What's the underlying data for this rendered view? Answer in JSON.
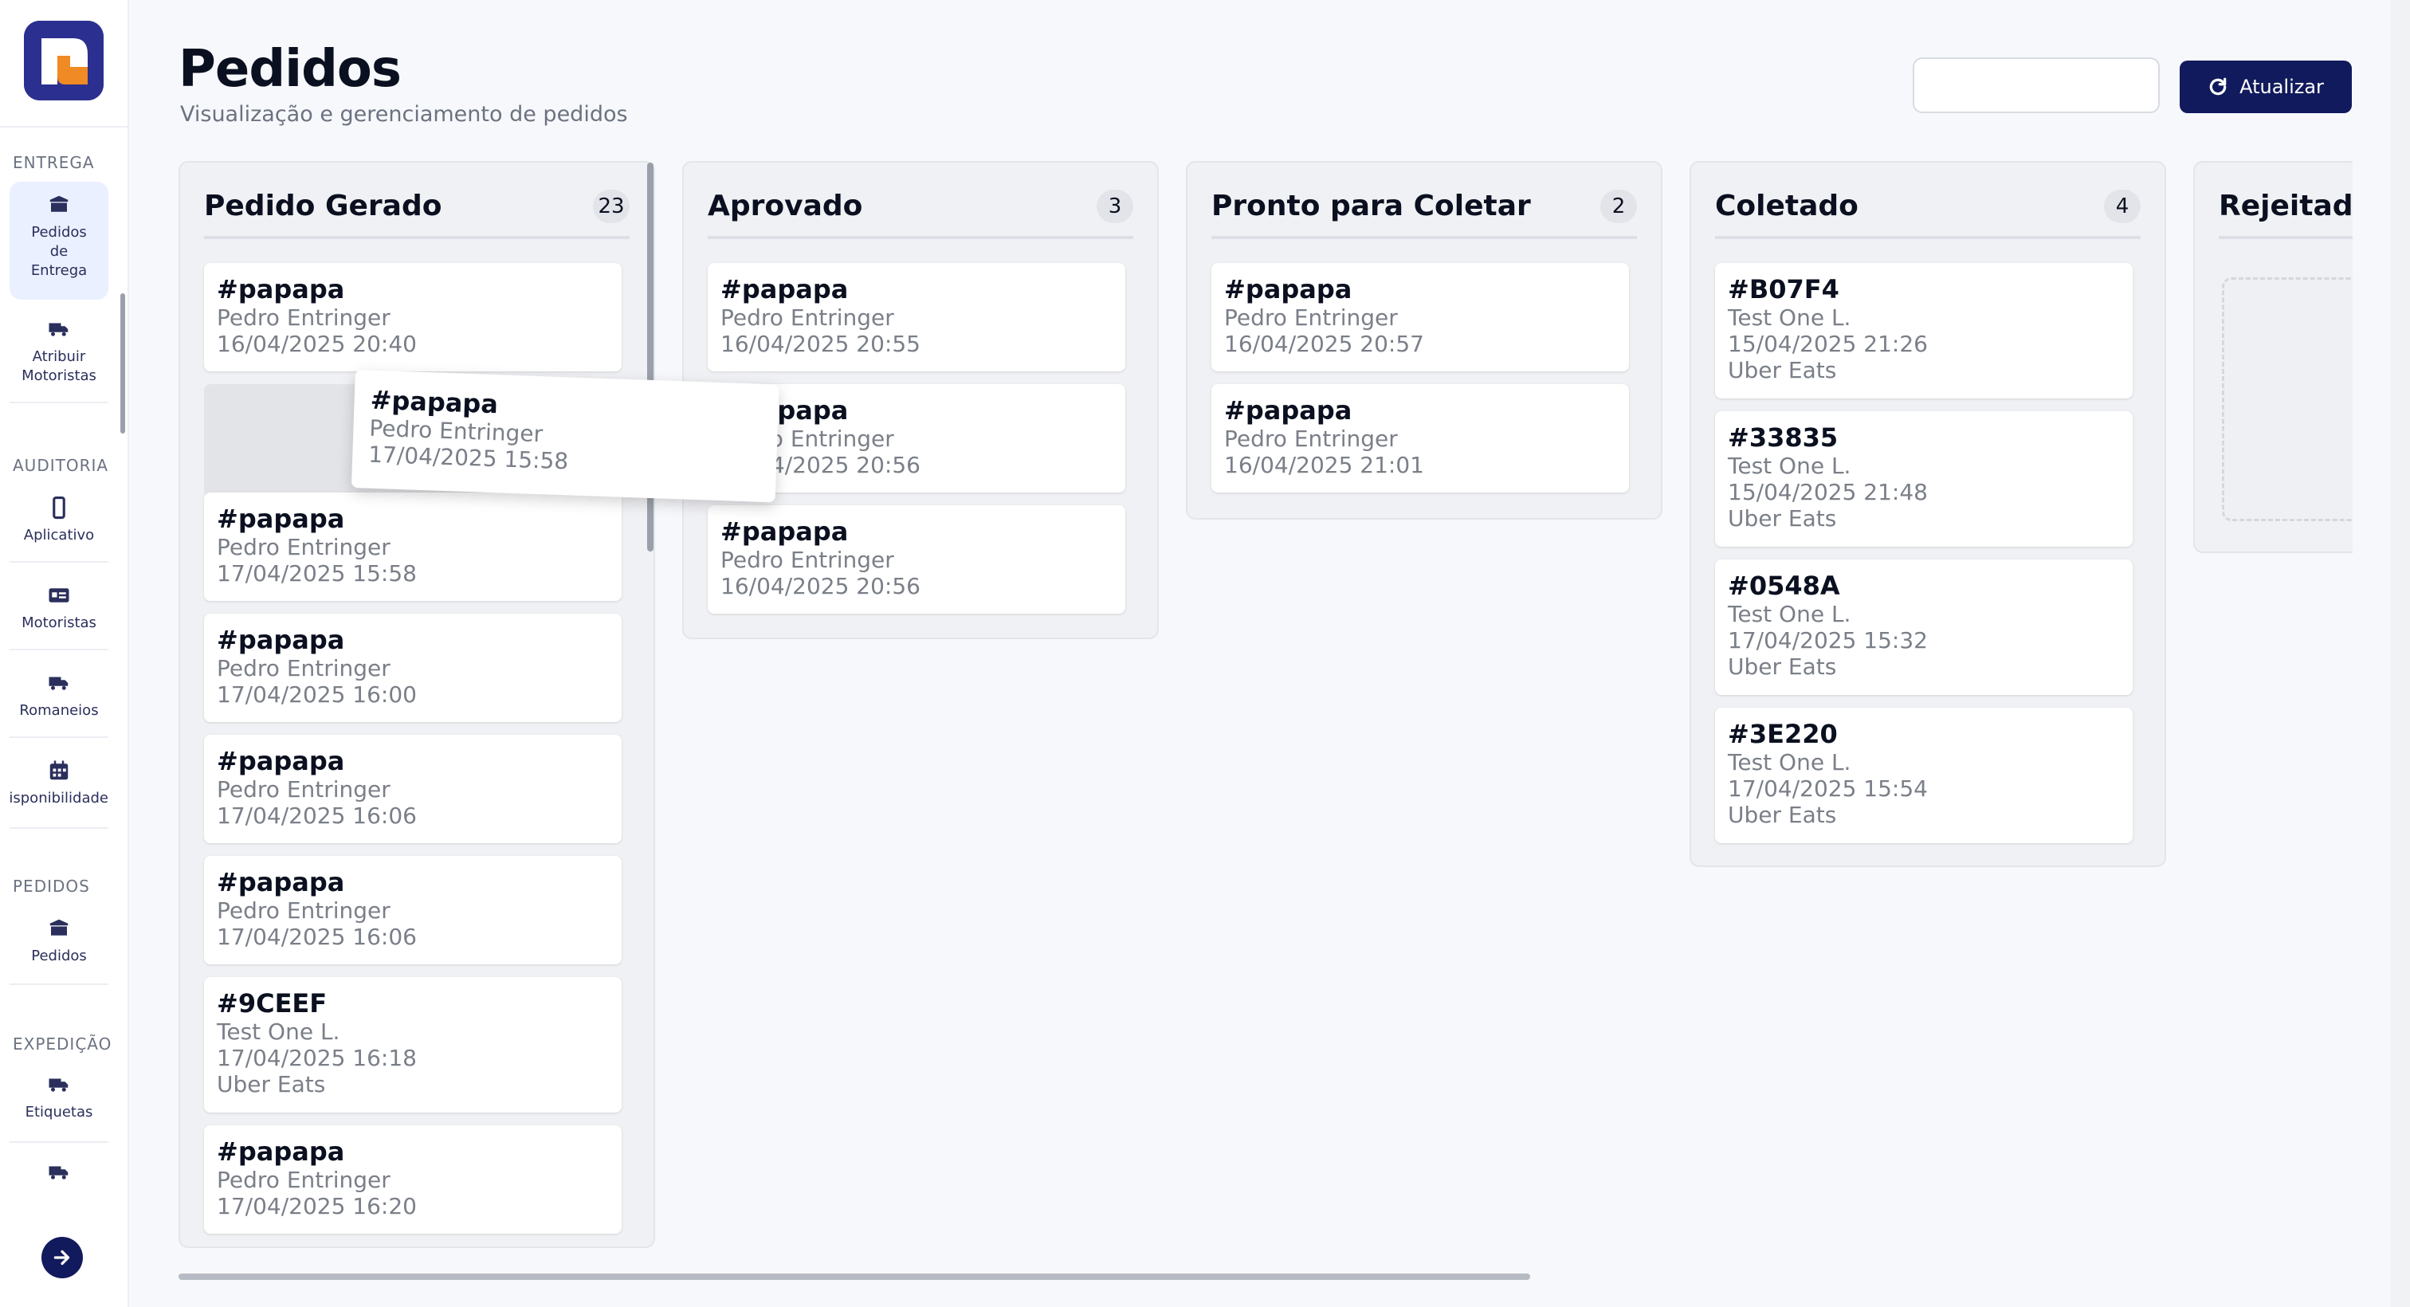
{
  "sidebar": {
    "sections": [
      {
        "title": "ENTREGA",
        "items": [
          {
            "label": "Pedidos de Entrega",
            "icon": "box-icon",
            "active": true
          },
          {
            "label": "Atribuir Motoristas",
            "icon": "truck-fast-icon"
          }
        ]
      },
      {
        "title": "AUDITORIA",
        "items": [
          {
            "label": "Aplicativo",
            "icon": "mobile-icon"
          },
          {
            "label": "Motoristas",
            "icon": "id-card-icon"
          },
          {
            "label": "Romaneios",
            "icon": "truck-icon"
          },
          {
            "label": "Disponibilidade",
            "icon": "calendar-icon"
          }
        ]
      },
      {
        "title": "PEDIDOS",
        "items": [
          {
            "label": "Pedidos",
            "icon": "box-icon"
          }
        ]
      },
      {
        "title": "EXPEDIÇÃO",
        "items": [
          {
            "label": "Etiquetas",
            "icon": "truck-fast-icon"
          },
          {
            "label": "",
            "icon": "truck-fast-icon"
          }
        ]
      }
    ],
    "expand_icon": "arrow-right-icon"
  },
  "header": {
    "title": "Pedidos",
    "subtitle": "Visualização e gerenciamento de pedidos",
    "search_value": "",
    "refresh_label": "Atualizar",
    "accent": "#111a5c"
  },
  "board": {
    "columns": [
      {
        "title": "Pedido Gerado",
        "count": "23",
        "cards": [
          {
            "id": "#papapa",
            "name": "Pedro Entringer",
            "date": "16/04/2025 20:40"
          },
          {
            "id": "#papapa",
            "name": "Pedro Entringer",
            "date": "17/04/2025 15:58"
          },
          {
            "id": "#papapa",
            "name": "Pedro Entringer",
            "date": "17/04/2025 16:00"
          },
          {
            "id": "#papapa",
            "name": "Pedro Entringer",
            "date": "17/04/2025 16:06"
          },
          {
            "id": "#papapa",
            "name": "Pedro Entringer",
            "date": "17/04/2025 16:06"
          },
          {
            "id": "#9CEEF",
            "name": "Test One L.",
            "date": "17/04/2025 16:18",
            "source": "Uber Eats"
          },
          {
            "id": "#papapa",
            "name": "Pedro Entringer",
            "date": "17/04/2025 16:20"
          }
        ]
      },
      {
        "title": "Aprovado",
        "count": "3",
        "cards": [
          {
            "id": "#papapa",
            "name": "Pedro Entringer",
            "date": "16/04/2025 20:55"
          },
          {
            "id": "#papapa",
            "name": "Pedro Entringer",
            "date": "16/04/2025 20:56"
          },
          {
            "id": "#papapa",
            "name": "Pedro Entringer",
            "date": "16/04/2025 20:56"
          }
        ]
      },
      {
        "title": "Pronto para Coletar",
        "count": "2",
        "cards": [
          {
            "id": "#papapa",
            "name": "Pedro Entringer",
            "date": "16/04/2025 20:57"
          },
          {
            "id": "#papapa",
            "name": "Pedro Entringer",
            "date": "16/04/2025 21:01"
          }
        ]
      },
      {
        "title": "Coletado",
        "count": "4",
        "cards": [
          {
            "id": "#B07F4",
            "name": "Test One L.",
            "date": "15/04/2025 21:26",
            "source": "Uber Eats"
          },
          {
            "id": "#33835",
            "name": "Test One L.",
            "date": "15/04/2025 21:48",
            "source": "Uber Eats"
          },
          {
            "id": "#0548A",
            "name": "Test One L.",
            "date": "17/04/2025 15:32",
            "source": "Uber Eats"
          },
          {
            "id": "#3E220",
            "name": "Test One L.",
            "date": "17/04/2025 15:54",
            "source": "Uber Eats"
          }
        ]
      },
      {
        "title": "Rejeitado",
        "count": "",
        "cards": []
      }
    ],
    "dragging_card": {
      "id": "#papapa",
      "name": "Pedro Entringer",
      "date": "17/04/2025 15:58"
    }
  }
}
